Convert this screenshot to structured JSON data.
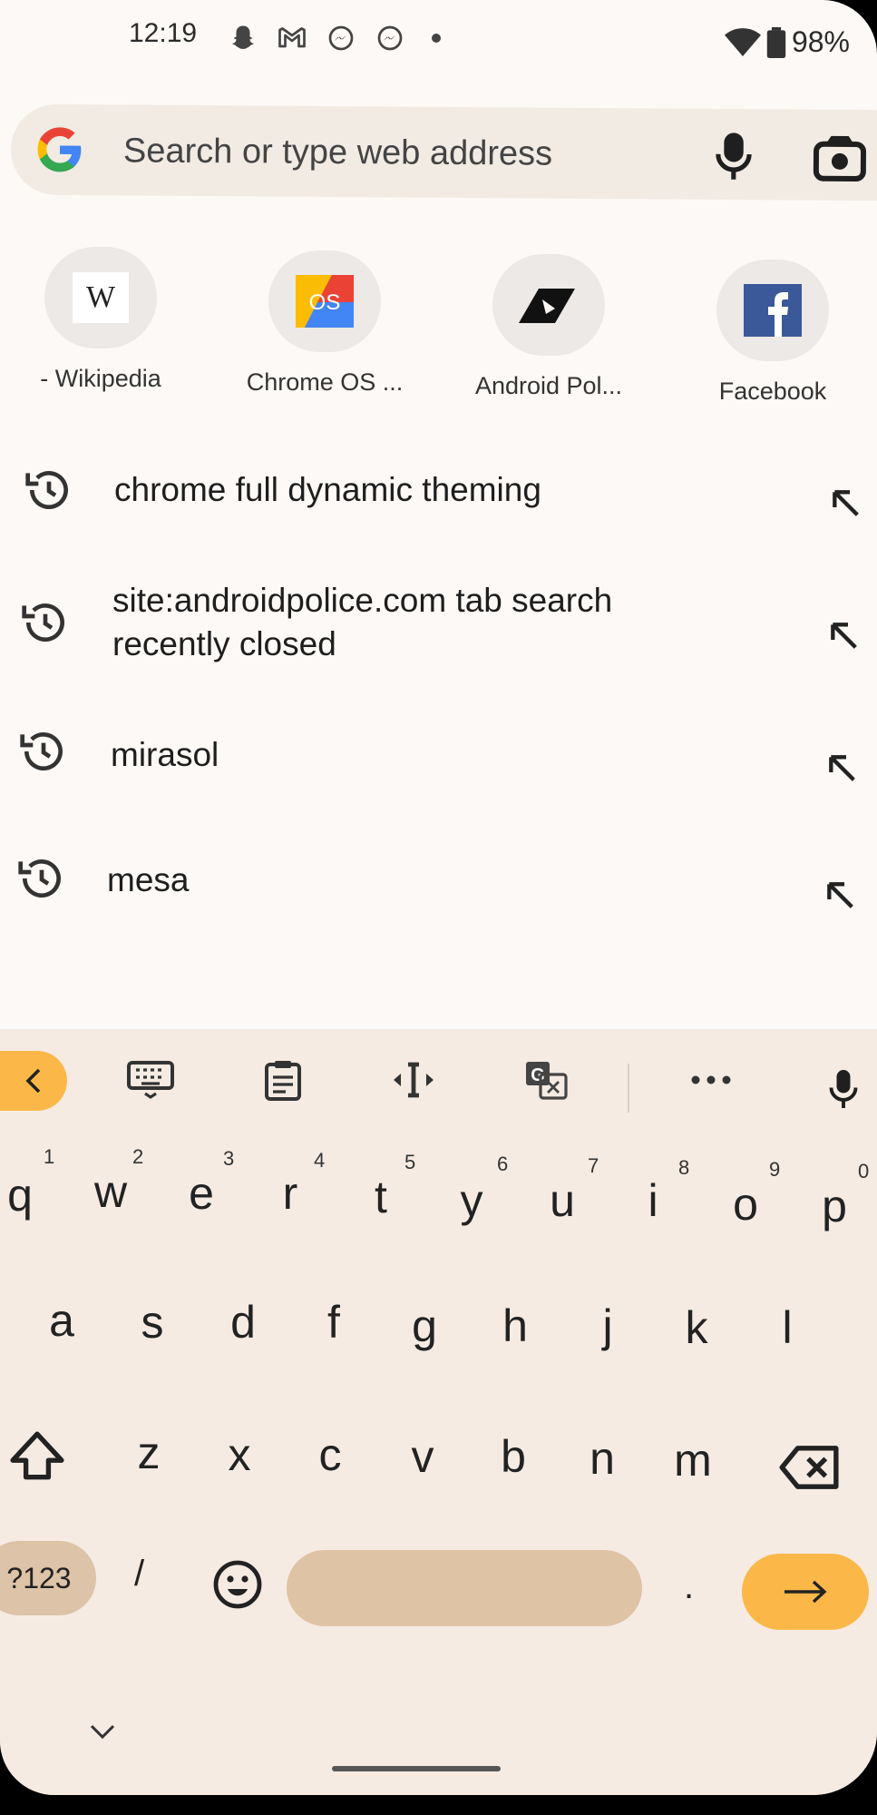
{
  "status_bar": {
    "time": "12:19",
    "notification_icons": [
      "snapchat-icon",
      "gmail-icon",
      "messenger-icon",
      "messenger-icon"
    ],
    "battery": "98%"
  },
  "search": {
    "placeholder": "Search or type web address"
  },
  "shortcuts": [
    {
      "label": "- Wikipedia",
      "icon": "wikipedia-icon"
    },
    {
      "label": "Chrome OS ...",
      "icon": "chrome-os-icon"
    },
    {
      "label": "Android Pol...",
      "icon": "android-police-icon"
    },
    {
      "label": "Facebook",
      "icon": "facebook-icon"
    }
  ],
  "suggestions": [
    {
      "line1": "chrome full dynamic theming",
      "line2": ""
    },
    {
      "line1": "site:androidpolice.com tab search",
      "line2": "recently closed"
    },
    {
      "line1": "mirasol",
      "line2": ""
    },
    {
      "line1": "mesa",
      "line2": ""
    }
  ],
  "keyboard": {
    "row1": [
      "q",
      "w",
      "e",
      "r",
      "t",
      "y",
      "u",
      "i",
      "o",
      "p"
    ],
    "row1_hints": [
      "1",
      "2",
      "3",
      "4",
      "5",
      "6",
      "7",
      "8",
      "9",
      "0"
    ],
    "row2": [
      "a",
      "s",
      "d",
      "f",
      "g",
      "h",
      "j",
      "k",
      "l"
    ],
    "row3": [
      "z",
      "x",
      "c",
      "v",
      "b",
      "n",
      "m"
    ],
    "symbols_label": "?123",
    "slash": "/",
    "period": ".",
    "colors": {
      "accent": "#fbb848",
      "space": "#dfc3a5",
      "background": "#f5ebe3"
    }
  }
}
